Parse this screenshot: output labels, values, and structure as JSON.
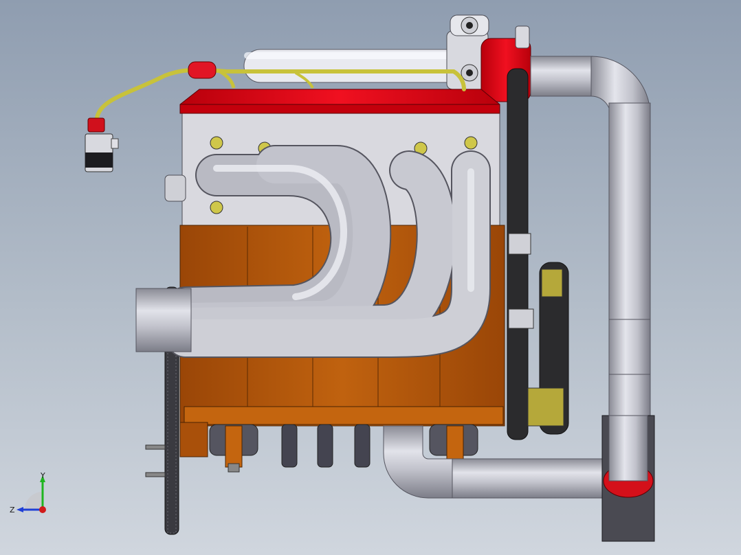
{
  "viewport": {
    "background_top": "#8f9db0",
    "background_bottom": "#d0d6de"
  },
  "colors": {
    "block": "#b8570b",
    "block_dark": "#8a3e05",
    "head": "#d6d6dc",
    "valve_cover": "#e3000f",
    "pipe": "#b9bac3",
    "wire": "#c8c23a",
    "belt": "#2b2b2d"
  },
  "triad": {
    "y_label": "Y",
    "z_label": "Z",
    "y_color": "#1fb51f",
    "z_color": "#1f3fd6",
    "origin_color": "#d11a1a"
  }
}
